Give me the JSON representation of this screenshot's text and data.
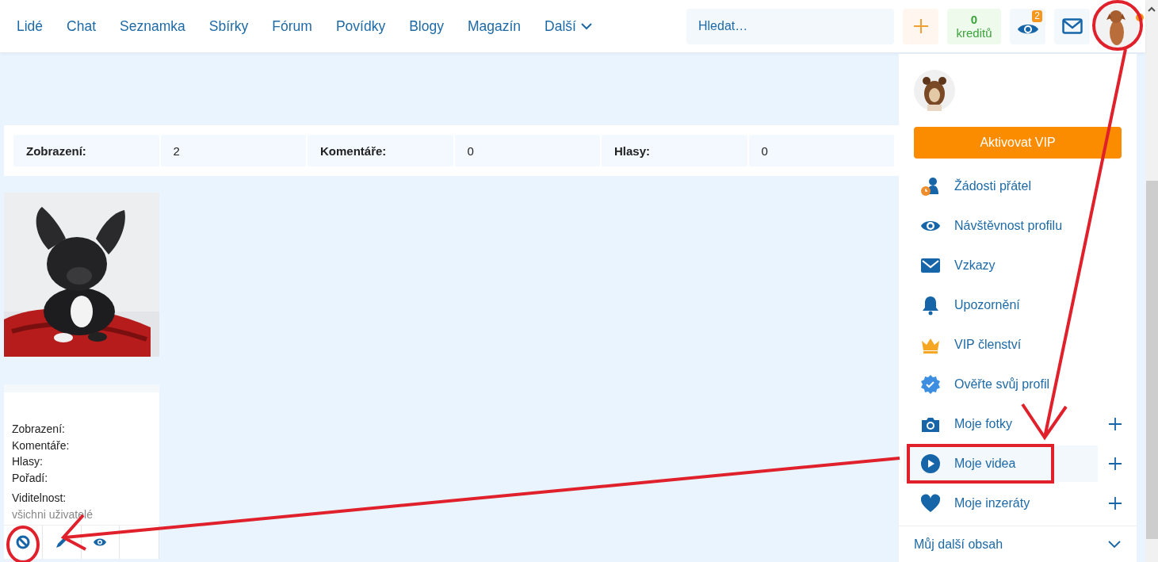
{
  "nav": {
    "items": [
      "Lidé",
      "Chat",
      "Seznamka",
      "Sbírky",
      "Fórum",
      "Povídky",
      "Blogy",
      "Magazín"
    ],
    "more": "Další"
  },
  "search": {
    "placeholder": "Hledat…"
  },
  "credits": {
    "count": "0",
    "label": "kreditů"
  },
  "visits": {
    "badge": "2"
  },
  "user": {
    "online": true
  },
  "stats": [
    {
      "label": "Zobrazení:",
      "value": "2"
    },
    {
      "label": "Komentáře:",
      "value": "0"
    },
    {
      "label": "Hlasy:",
      "value": "0"
    }
  ],
  "card": {
    "labels": [
      "Zobrazení:",
      "Komentáře:",
      "Hlasy:",
      "Pořadí:"
    ],
    "visibility_label": "Viditelnost:",
    "visibility_value": "všichni uživatelé"
  },
  "menu": {
    "vip_button": "Aktivovat VIP",
    "items": [
      {
        "label": "Žádosti přátel",
        "add": false,
        "selected": false
      },
      {
        "label": "Návštěvnost profilu",
        "add": false,
        "selected": false
      },
      {
        "label": "Vzkazy",
        "add": false,
        "selected": false
      },
      {
        "label": "Upozornění",
        "add": false,
        "selected": false
      },
      {
        "label": "VIP členství",
        "add": false,
        "selected": false
      },
      {
        "label": "Ověřte svůj profil",
        "add": false,
        "selected": false
      },
      {
        "label": "Moje fotky",
        "add": true,
        "selected": false
      },
      {
        "label": "Moje videa",
        "add": true,
        "selected": true
      },
      {
        "label": "Moje inzeráty",
        "add": true,
        "selected": false
      }
    ],
    "footer": {
      "label": "Můj další obsah",
      "expanded": false
    }
  }
}
